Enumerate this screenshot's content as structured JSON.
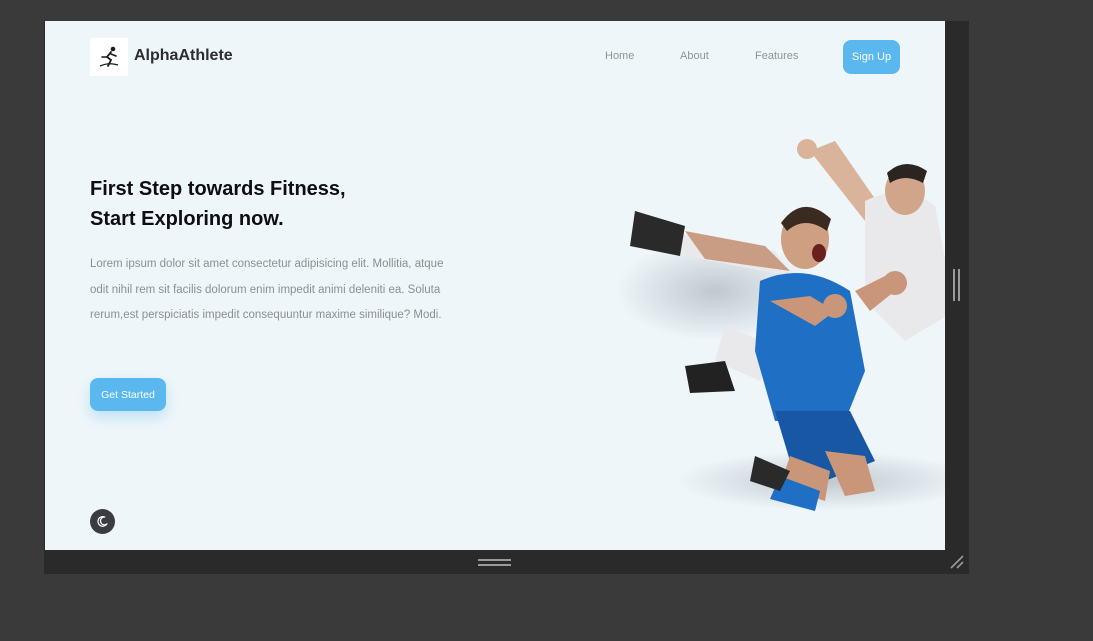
{
  "brand": {
    "name": "AlphaAthlete",
    "logo_icon": "runner-logo-icon"
  },
  "nav": {
    "links": [
      "Home",
      "About",
      "Features"
    ],
    "signup_label": "Sign Up"
  },
  "hero": {
    "title_line1": "First Step towards Fitness,",
    "title_line2": "Start Exploring now.",
    "body": "Lorem ipsum dolor sit amet consectetur adipisicing elit. Mollitia, atque odit nihil rem sit facilis dolorum enim impedit animi deleniti ea. Soluta rerum,est perspiciatis impedit consequuntur maxime similique? Modi.",
    "cta_label": "Get Started",
    "image_subject": "soccer-players-celebrating"
  },
  "theme_toggle": {
    "icon": "moon-icon"
  },
  "colors": {
    "accent": "#5bb8ee",
    "page_bg": "#eff6fa",
    "heading": "#0d0d12",
    "muted_text": "#8a8f94",
    "toggle_bg": "#3b3b44",
    "jersey_blue": "#1f6fc4",
    "jersey_white": "#e9e9ec"
  }
}
